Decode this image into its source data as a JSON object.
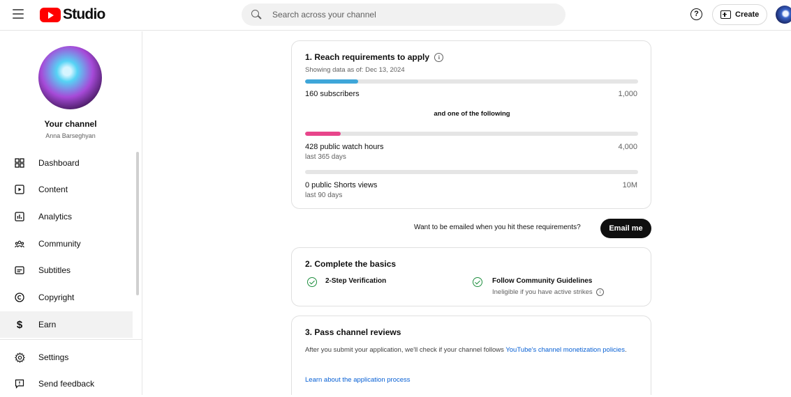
{
  "header": {
    "logo_text": "Studio",
    "search_placeholder": "Search across your channel",
    "help_label": "?",
    "create_label": "Create"
  },
  "sidebar": {
    "channel_title": "Your channel",
    "channel_owner": "Anna Barseghyan",
    "items": [
      {
        "label": "Dashboard",
        "icon": "dashboard-icon"
      },
      {
        "label": "Content",
        "icon": "content-icon"
      },
      {
        "label": "Analytics",
        "icon": "analytics-icon"
      },
      {
        "label": "Community",
        "icon": "community-icon"
      },
      {
        "label": "Subtitles",
        "icon": "subtitles-icon"
      },
      {
        "label": "Copyright",
        "icon": "copyright-icon"
      },
      {
        "label": "Earn",
        "icon": "earn-icon",
        "active": true
      },
      {
        "label": "Settings",
        "icon": "settings-icon"
      },
      {
        "label": "Send feedback",
        "icon": "feedback-icon"
      }
    ]
  },
  "requirements": {
    "title": "1. Reach requirements to apply",
    "as_of": "Showing data as of: Dec 13, 2024",
    "subscribers": {
      "label": "160 subscribers",
      "target": "1,000",
      "progress": 0.16,
      "color": "#3ea6d9"
    },
    "separator": "and one of the following",
    "watch_hours": {
      "label": "428 public watch hours",
      "sub": "last 365 days",
      "target": "4,000",
      "progress": 0.107,
      "color": "#e8458b"
    },
    "shorts_views": {
      "label": "0 public Shorts views",
      "sub": "last 90 days",
      "target": "10M",
      "progress": 0
    }
  },
  "email": {
    "prompt": "Want to be emailed when you hit these requirements?",
    "button": "Email me"
  },
  "basics": {
    "title": "2. Complete the basics",
    "item1": "2-Step Verification",
    "item2": "Follow Community Guidelines",
    "item2_sub": "Ineligible if you have active strikes"
  },
  "reviews": {
    "title": "3. Pass channel reviews",
    "text_prefix": "After you submit your application, we'll check if your channel follows ",
    "policy_link": "YouTube's channel monetization policies",
    "text_suffix": ".",
    "learn_link": "Learn about the application process"
  }
}
